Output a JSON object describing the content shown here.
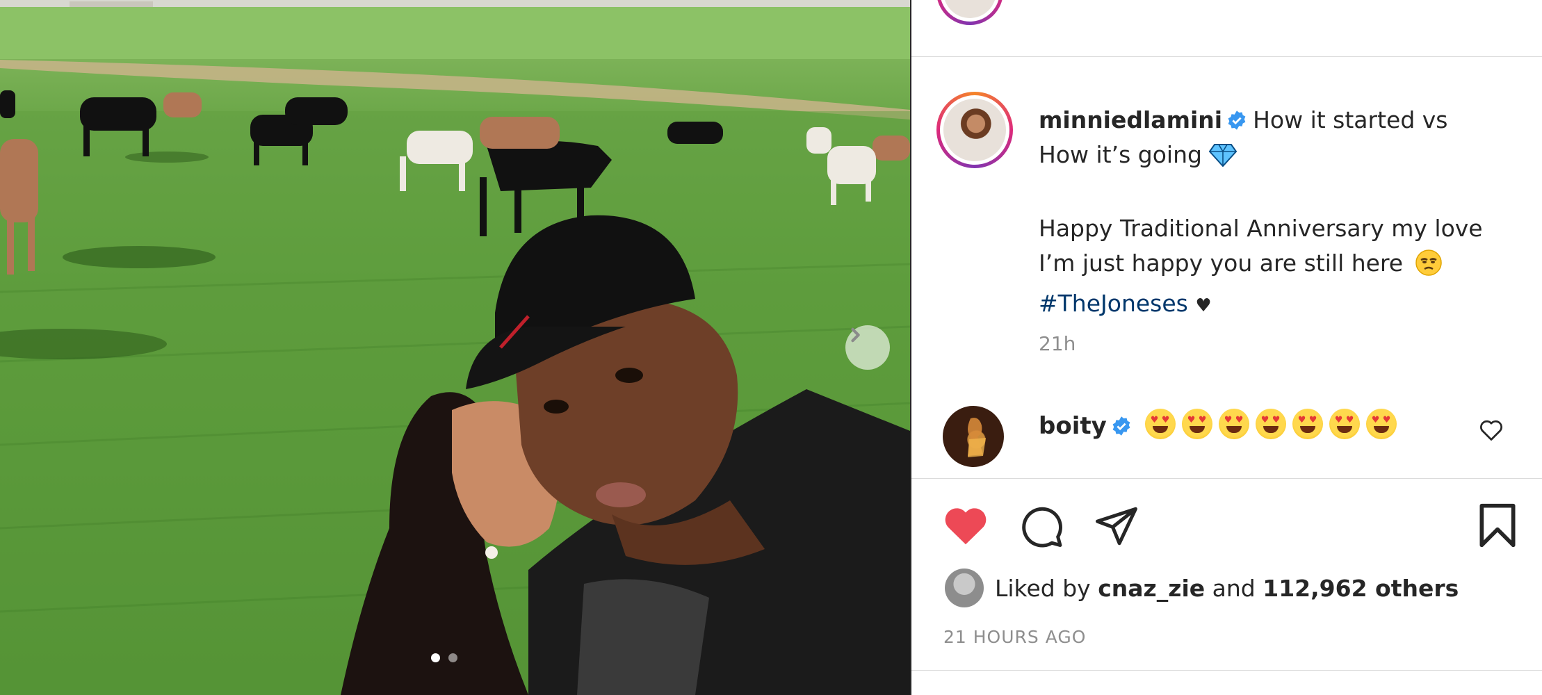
{
  "post": {
    "username": "minniedlamini",
    "caption_line1": "How it started vs",
    "caption_line2": "How it’s going",
    "caption_line3": "Happy Traditional Anniversary my love",
    "caption_line4": "I’m just happy you are still here",
    "hashtag": "#TheJoneses",
    "heart_symbol": "♥",
    "time_short": "21h"
  },
  "comment": {
    "username": "boity",
    "emoji_count": 7,
    "emoji_name": "heart-eyes"
  },
  "likes": {
    "prefix": "Liked by",
    "liker": "cnaz_zie",
    "middle": "and",
    "count_text": "112,962 others"
  },
  "timestamp": "21 HOURS AGO",
  "carousel": {
    "total_slides": 2,
    "active_index": 0
  },
  "colors": {
    "like_red": "#ed4956",
    "verified_blue": "#3897f0",
    "hashtag_blue": "#00376b",
    "muted_gray": "#8e8e8e"
  },
  "icons": [
    "chevron-right-icon",
    "verified-badge-icon",
    "diamond-icon",
    "sad-face-icon",
    "heart-outline-icon",
    "heart-filled-icon",
    "comment-icon",
    "share-icon",
    "bookmark-icon"
  ]
}
